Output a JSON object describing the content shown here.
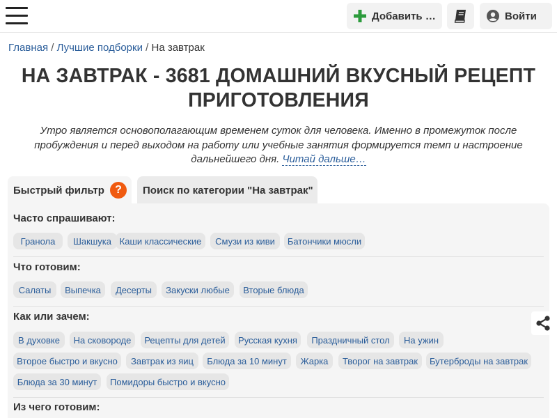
{
  "header": {
    "add_label": "Добавить …",
    "login_label": "Войти",
    "accent_color": "#2c9b3c"
  },
  "breadcrumb": {
    "home": "Главная",
    "collections": "Лучшие подборки",
    "current": "На завтрак",
    "separator": "/"
  },
  "title": {
    "line1": "НА ЗАВТРАК - 3681 ДОМАШНИЙ ВКУСНЫЙ РЕЦЕПТ",
    "line2": "ПРИГОТОВЛЕНИЯ"
  },
  "description": {
    "line1": "Утро является основополагающим временем суток для человека. Именно в промежуток после",
    "line2": "пробуждения и перед выходом на работу или учебные занятия формируется темп и настроение",
    "line3": "дальнейшего дня.",
    "more": "Читай дальше…"
  },
  "tabs": {
    "quick_filter": "Быстрый фильтр",
    "help": "?",
    "category_search": "Поиск по категории \"На завтрак\""
  },
  "filters": {
    "faq": {
      "heading": "Часто спрашивают:",
      "chips": [
        "Гранола",
        "Шакшука",
        "Каши классические",
        "Смузи из киви",
        "Батончики мюсли"
      ]
    },
    "what": {
      "heading": "Что готовим:",
      "chips": [
        "Салаты",
        "Выпечка",
        "Десерты",
        "Закуски любые",
        "Вторые блюда"
      ]
    },
    "how": {
      "heading": "Как или зачем:",
      "chips": [
        "В духовке",
        "На сковороде",
        "Рецепты для детей",
        "Русская кухня",
        "Праздничный стол",
        "На ужин",
        "Второе быстро и вкусно",
        "Завтрак из яиц",
        "Блюда за 10 минут",
        "Жарка",
        "Творог на завтрак",
        "Бутерброды на завтрак",
        "Блюда за 30 минут",
        "Помидоры быстро и вкусно"
      ]
    },
    "from": {
      "heading": "Из чего готовим:"
    }
  },
  "icons": {
    "menu": "hamburger-icon",
    "add": "plus-icon",
    "book": "book-icon",
    "user": "user-icon",
    "share": "share-icon"
  }
}
